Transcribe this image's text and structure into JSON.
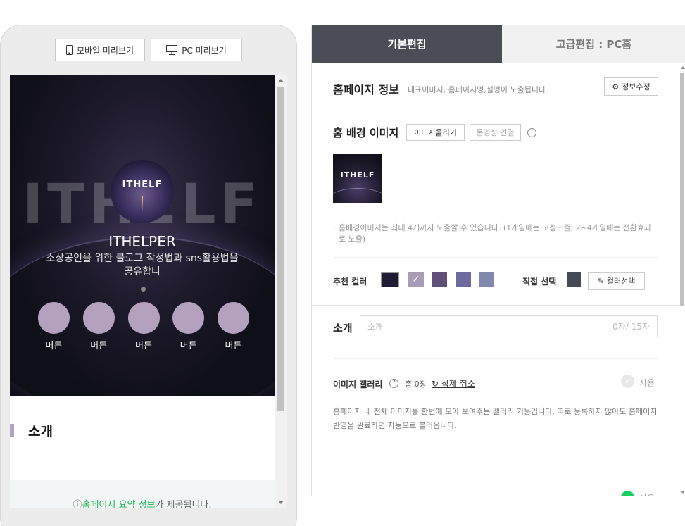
{
  "preview": {
    "mobile_button": "모바일 미리보기",
    "pc_button": "PC 미리보기",
    "hero": {
      "background_text": "ITHELF",
      "logo_text": "ITHELF",
      "title": "ITHELPER",
      "description": "소상공인을 위한 블로그 작성법과 sns활용법을 공유합니",
      "buttons": [
        "버튼",
        "버튼",
        "버튼",
        "버튼",
        "버튼"
      ],
      "button_color": "#b3a1bd"
    },
    "intro_heading": "소개",
    "summary_prefix": "ⓘ",
    "summary_link": "홈페이지 요약 정보",
    "summary_suffix": "가 제공됩니다."
  },
  "editor": {
    "tabs": [
      {
        "label": "기본편집",
        "active": true
      },
      {
        "label": "고급편집 : PC홈",
        "active": false
      }
    ],
    "homepage_info": {
      "title": "홈페이지 정보",
      "subtitle": "대표이미지, 홈페이지명,설명이 노출됩니다.",
      "edit_button": "정보수정"
    },
    "background_image": {
      "title": "홈 배경 이미지",
      "upload_button": "이미지올리기",
      "video_button": "동영상 연결",
      "thumbnail_text": "ITHELF",
      "note": "홈배경이미지는 최대 4개까지 노출할 수 있습니다. (1개일때는 고정노출, 2~4개일때는 전환효과로 노출)"
    },
    "colors": {
      "recommended_label": "추천 컬러",
      "swatches": [
        "#1e1b33",
        "#a99bb5",
        "#5e5078",
        "#6e6a9e",
        "#8188ad"
      ],
      "selected_index": 1,
      "direct_label": "직접 선택",
      "direct_color": "#454b55",
      "picker_button": "컬러선택"
    },
    "intro": {
      "label": "소개",
      "placeholder": "소개",
      "counter": "0자/ 15자"
    },
    "gallery": {
      "title": "이미지 갤러리",
      "count": "총 0장",
      "undo": "삭제 취소",
      "use_label": "사용",
      "description": "홈페이지 내 전체 이미지를 한번에 모아 보여주는 갤러리 기능입니다. 따로 등록하지 않아도 홈페이지 반영을 완료하면 자동으로 불러옵니다."
    },
    "bottom": {
      "use_label": "사용"
    }
  }
}
